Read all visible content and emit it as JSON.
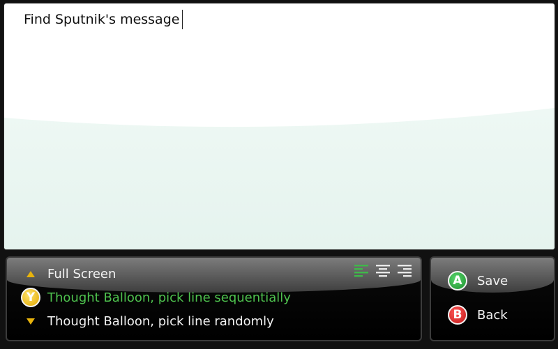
{
  "editor": {
    "text": "Find Sputnik's message"
  },
  "options": {
    "items": [
      {
        "label": "Full Screen",
        "lead_icon": "arrow-up-icon"
      },
      {
        "label": "Thought Balloon, pick line sequentially",
        "lead_icon": "y-button-icon",
        "lead_glyph": "Y",
        "selected": true
      },
      {
        "label": "Thought Balloon, pick line randomly",
        "lead_icon": "arrow-down-icon"
      }
    ],
    "alignment": {
      "selected": "left",
      "icons": [
        "align-left-icon",
        "align-center-icon",
        "align-right-icon"
      ]
    }
  },
  "actions": {
    "save": {
      "glyph": "A",
      "label": "Save"
    },
    "back": {
      "glyph": "B",
      "label": "Back"
    }
  },
  "colors": {
    "selected_text": "#4ec24e",
    "arrow": "#e8b30c",
    "button_a": "#1e8f2f",
    "button_b": "#c01616",
    "button_y": "#e0a800"
  }
}
